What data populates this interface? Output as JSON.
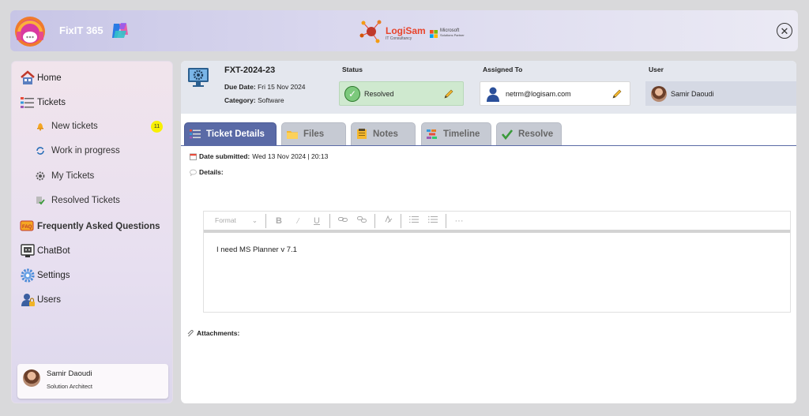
{
  "app": {
    "name": "FixIT 365"
  },
  "brand": {
    "name": "LogiSam",
    "subtitle": "IT Consultancy",
    "partner_line1": "Microsoft",
    "partner_line2": "Solutions Partner"
  },
  "sidebar": {
    "items": [
      {
        "label": "Home",
        "icon": "home-icon"
      },
      {
        "label": "Tickets",
        "icon": "tickets-icon"
      },
      {
        "label": "Frequently Asked Questions",
        "icon": "faq-icon"
      },
      {
        "label": "ChatBot",
        "icon": "chatbot-icon"
      },
      {
        "label": "Settings",
        "icon": "gear-icon"
      },
      {
        "label": "Users",
        "icon": "users-lock-icon"
      }
    ],
    "sub_items": [
      {
        "label": "New tickets",
        "icon": "bell-icon",
        "badge": "11"
      },
      {
        "label": "Work in progress",
        "icon": "refresh-icon"
      },
      {
        "label": "My Tickets",
        "icon": "user-gear-icon"
      },
      {
        "label": "Resolved Tickets",
        "icon": "resolved-icon"
      }
    ],
    "user": {
      "name": "Samir Daoudi",
      "role": "Solution Architect"
    }
  },
  "ticket": {
    "id": "FXT-2024-23",
    "due_label": "Due Date:",
    "due_value": "Fri 15 Nov 2024",
    "category_label": "Category:",
    "category_value": "Software",
    "status_label": "Status",
    "status_value": "Resolved",
    "assigned_label": "Assigned To",
    "assigned_value": "netrm@logisam.com",
    "user_label": "User",
    "user_value": "Samir Daoudi"
  },
  "tabs": [
    {
      "label": "Ticket Details",
      "icon": "details-icon",
      "active": true
    },
    {
      "label": "Files",
      "icon": "folder-icon",
      "active": false
    },
    {
      "label": "Notes",
      "icon": "notes-icon",
      "active": false
    },
    {
      "label": "Timeline",
      "icon": "timeline-icon",
      "active": false
    },
    {
      "label": "Resolve",
      "icon": "check-icon",
      "active": false
    }
  ],
  "details": {
    "date_label": "Date submitted:",
    "date_value": "Wed 13 Nov 2024 | 20:13",
    "details_label": "Details:",
    "attachments_label": "Attachments:"
  },
  "editor": {
    "format_label": "Format",
    "format_caret": "⌄",
    "bold": "B",
    "italic": "/",
    "underline": "U",
    "more": "···",
    "content": "I need MS Planner v 7.1"
  },
  "colors": {
    "accent": "#5a6aa6",
    "status_bg": "#cfe9cf",
    "badge": "#f8f000"
  }
}
